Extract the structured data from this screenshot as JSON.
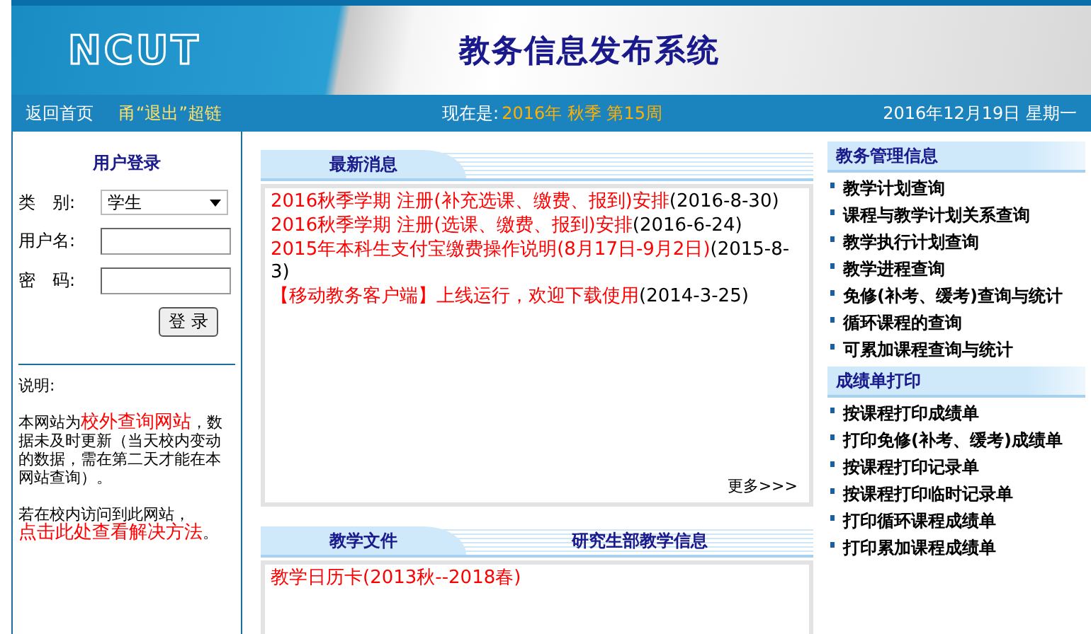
{
  "header": {
    "logo": "NCUT",
    "title": "教务信息发布系统"
  },
  "nav": {
    "home": "返回首页",
    "marquee": "甬“退出”超链",
    "now_label": "现在是:",
    "term": "2016年 秋季 第15周",
    "date": "2016年12月19日 星期一"
  },
  "login": {
    "title": "用户登录",
    "type_label": "类　别:",
    "type_value": "学生",
    "user_label": "用户名:",
    "password_label": "密　码:",
    "button": "登 录"
  },
  "notice": {
    "title": "说明:",
    "p1_text": "本网站为",
    "p1_link": "校外查询网站",
    "p1_rest": "，数据未及时更新（当天校内变动的数据，需在第二天才能在本网站查询）。",
    "p2_text": "若在校内访问到此网站，",
    "p2_link": "点击此处查看解决方法",
    "p2_end": "。"
  },
  "news": {
    "tab": "最新消息",
    "items": [
      {
        "title": "2016秋季学期 注册(补充选课、缴费、报到)安排",
        "date": "(2016-8-30)"
      },
      {
        "title": "2016秋季学期 注册(选课、缴费、报到)安排",
        "date": "(2016-6-24)"
      },
      {
        "title": "2015年本科生支付宝缴费操作说明(8月17日-9月2日)",
        "date": "(2015-8-3)"
      },
      {
        "title": "【移动教务客户端】上线运行，欢迎下载使用",
        "date": "(2014-3-25)"
      }
    ],
    "more": "更多>>>"
  },
  "docs": {
    "tabs": [
      {
        "label": "教学文件",
        "selected": true
      },
      {
        "label": "研究生部教学信息",
        "selected": false
      }
    ],
    "items": [
      "教学日历卡(2013秋--2018春)"
    ]
  },
  "sections": [
    {
      "title": "教务管理信息",
      "items": [
        "教学计划查询",
        "课程与教学计划关系查询",
        "教学执行计划查询",
        "教学进程查询",
        "免修(补考、缓考)查询与统计",
        "循环课程的查询",
        "可累加课程查询与统计"
      ]
    },
    {
      "title": "成绩单打印",
      "items": [
        "按课程打印成绩单",
        "打印免修(补考、缓考)成绩单",
        "按课程打印记录单",
        "按课程打印临时记录单",
        "打印循环课程成绩单",
        "打印累加课程成绩单"
      ]
    }
  ]
}
